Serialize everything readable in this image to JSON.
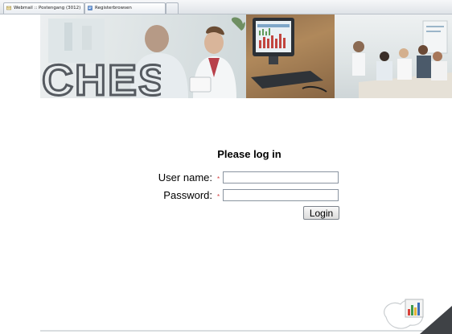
{
  "browser": {
    "tabs": [
      {
        "label": "Webmail :: Postengang (3012)",
        "icon": "mail-icon"
      },
      {
        "label": "Registerbrowsen",
        "icon": "browser-page-icon"
      }
    ]
  },
  "banner": {
    "logo_text": "CHES"
  },
  "login": {
    "title": "Please log in",
    "username_label": "User name:",
    "password_label": "Password:",
    "required_marker": "*",
    "username_value": "",
    "password_value": "",
    "submit_label": "Login"
  },
  "colors": {
    "required": "#d23b3b",
    "logo": "#555a60"
  }
}
